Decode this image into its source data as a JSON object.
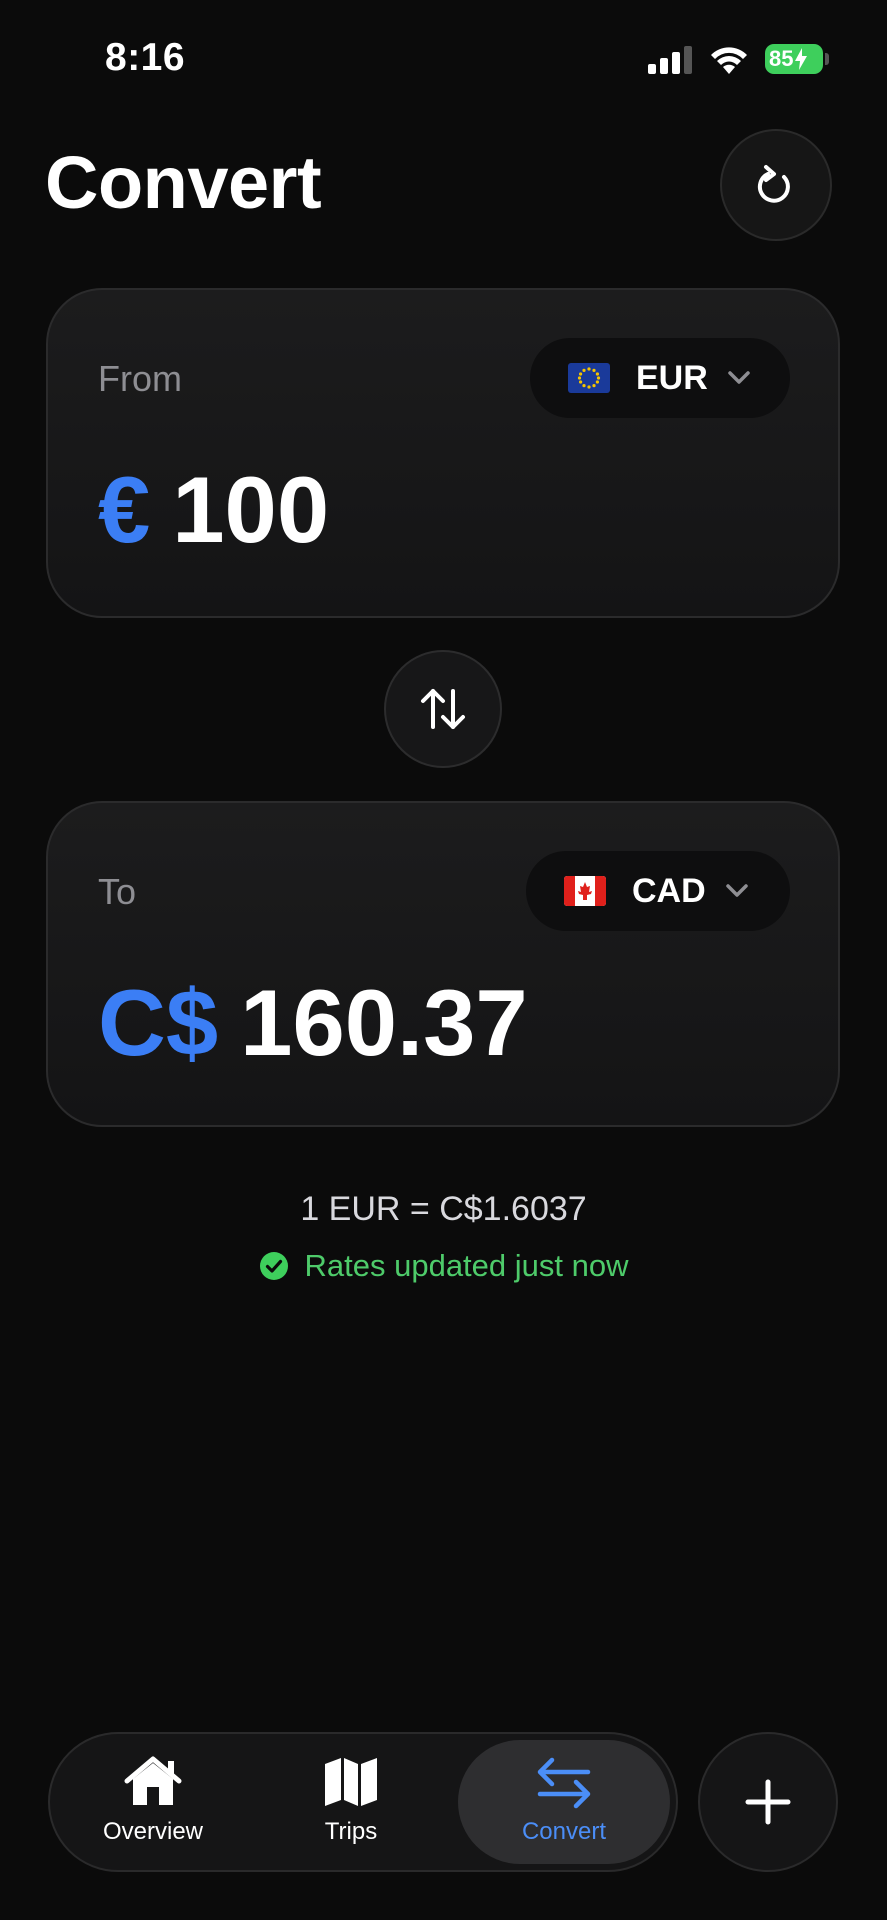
{
  "status_bar": {
    "time": "8:16",
    "battery": "85"
  },
  "header": {
    "title": "Convert",
    "refresh_icon": "refresh-icon"
  },
  "from_card": {
    "label": "From",
    "currency_code": "EUR",
    "flag_icon": "eu-flag-icon",
    "symbol": "€",
    "amount": "100"
  },
  "swap": {
    "icon": "swap-vertical-arrows-icon"
  },
  "to_card": {
    "label": "To",
    "currency_code": "CAD",
    "flag_icon": "canada-flag-icon",
    "symbol": "C$",
    "amount": "160.37"
  },
  "rate": {
    "text": "1 EUR = C$1.6037",
    "status": "Rates updated just now"
  },
  "tabbar": {
    "items": [
      {
        "label": "Overview",
        "icon": "house-icon",
        "active": false
      },
      {
        "label": "Trips",
        "icon": "map-icon",
        "active": false
      },
      {
        "label": "Convert",
        "icon": "swap-arrows-icon",
        "active": true
      }
    ],
    "add_icon": "plus-icon"
  },
  "colors": {
    "background": "#0b0b0b",
    "accent": "#3b7ef5",
    "success": "#4ecb6a",
    "battery": "#3ecf5c"
  }
}
